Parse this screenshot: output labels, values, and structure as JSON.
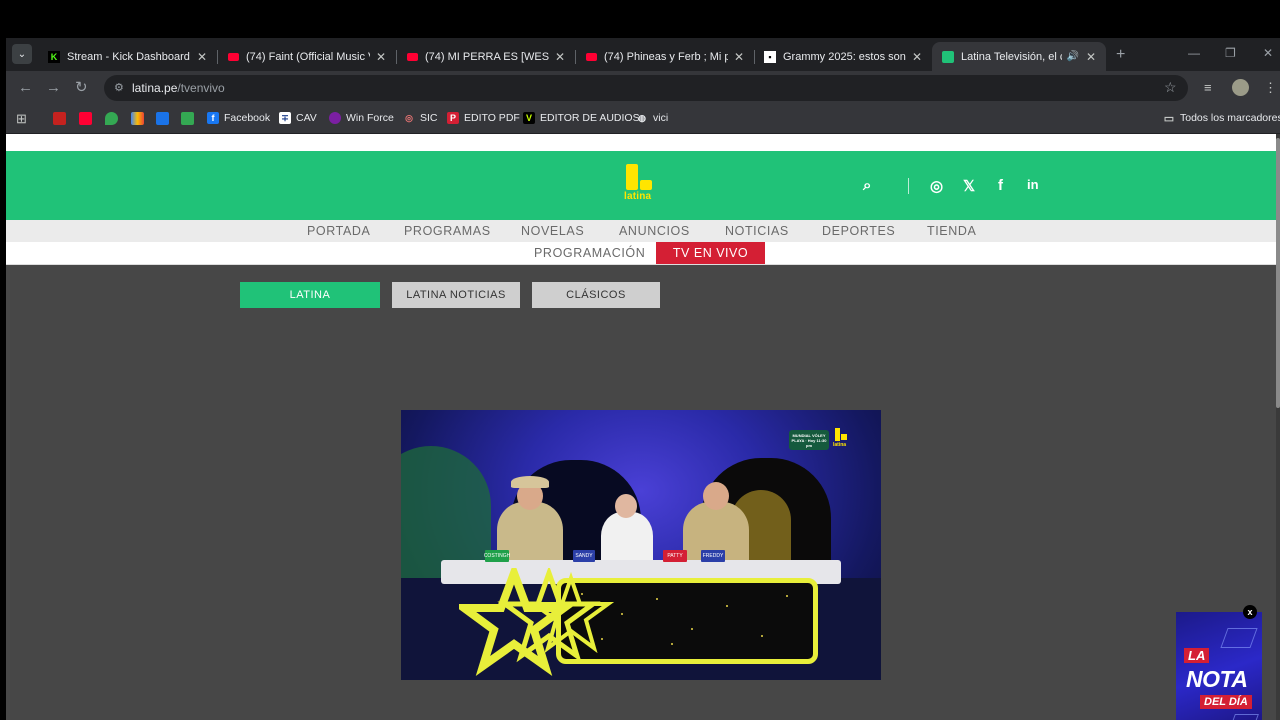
{
  "browser": {
    "tabs": [
      {
        "title": "Stream - Kick Dashboard",
        "icon": "kick-icon"
      },
      {
        "title": "(74) Faint (Official Music Vide",
        "icon": "youtube-icon"
      },
      {
        "title": "(74) MI PERRA ES [WESTCOL",
        "icon": "youtube-icon"
      },
      {
        "title": "(74) Phineas y Ferb ; Mi playl",
        "icon": "youtube-icon"
      },
      {
        "title": "Grammy 2025: estos son los",
        "icon": "news-icon"
      },
      {
        "title": "Latina Televisión, el canal",
        "icon": "latina-icon"
      }
    ],
    "url_domain": "latina.pe",
    "url_path": "/tvenvivo",
    "bookmarks": [
      "Facebook",
      "CAV",
      "Win Force",
      "SIC",
      "EDITO PDF",
      "EDITOR DE AUDIOS",
      "vici"
    ],
    "all_bookmarks": "Todos los marcadores"
  },
  "site": {
    "logo_text": "latina",
    "brand_color": "#20c278",
    "accent_color": "#d41f34",
    "menu_row1": [
      "PORTADA",
      "PROGRAMAS",
      "NOVELAS",
      "ANUNCIOS",
      "NOTICIAS",
      "DEPORTES",
      "TIENDA"
    ],
    "menu_row2": {
      "programacion": "PROGRAMACIÓN",
      "live": "TV EN VIVO"
    },
    "channels": [
      "LATINA",
      "LATINA NOTICIAS",
      "CLÁSICOS"
    ]
  },
  "video": {
    "bug_text": "MUNDIAL VÓLEY PLAYA · Hoy 11:30 pm",
    "bug_logo": "latina",
    "nameplates": [
      "COSTINGH",
      "SANDY",
      "PATTY",
      "FREDDY"
    ]
  },
  "ad": {
    "la": "LA",
    "nota": "NOTA",
    "dia": "DEL DÍA",
    "close": "x"
  }
}
